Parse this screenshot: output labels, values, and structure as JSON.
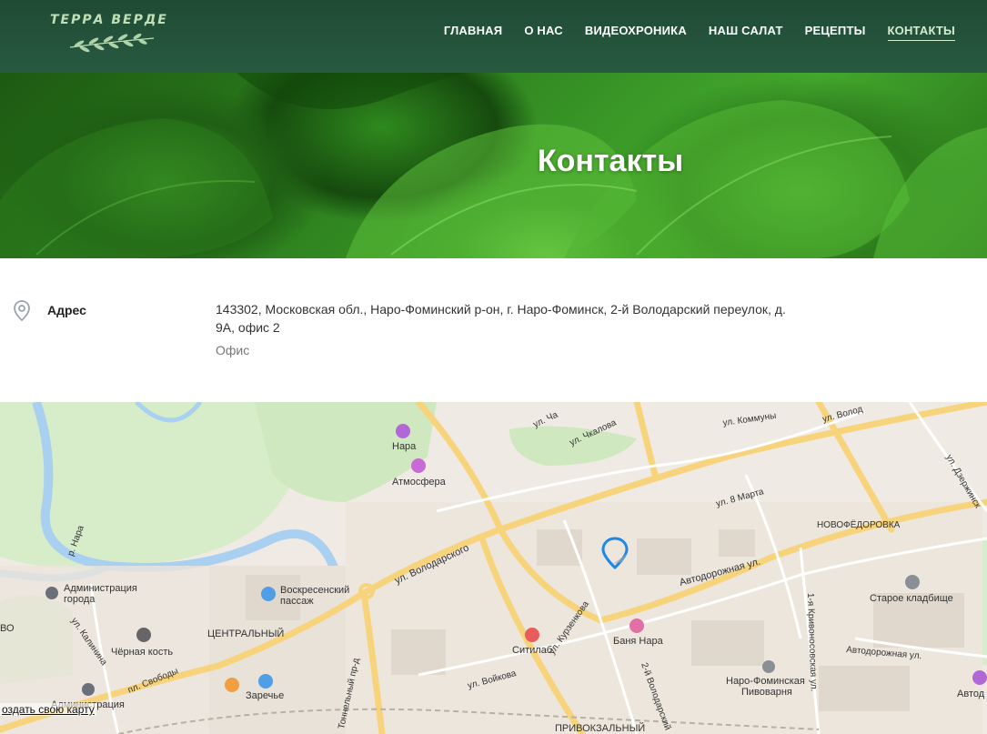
{
  "header": {
    "logo_text": "ТЕРРА ВЕРДЕ",
    "nav": [
      {
        "label": "ГЛАВНАЯ"
      },
      {
        "label": "О НАС"
      },
      {
        "label": "ВИДЕОХРОНИКА"
      },
      {
        "label": "НАШ САЛАТ"
      },
      {
        "label": "РЕЦЕПТЫ"
      },
      {
        "label": "КОНТАКТЫ",
        "active": true
      }
    ]
  },
  "hero": {
    "title": "Контакты"
  },
  "contact": {
    "icon": "location-pin-icon",
    "label": "Адрес",
    "address": "143302, Московская обл., Наро-Фоминский р-он, г. Наро-Фоминск, 2-й Володарский переулок, д. 9А, офис 2",
    "type": "Офис"
  },
  "map": {
    "labels": {
      "nara_river": "р. Нара",
      "nara_poi": "Нара",
      "atmosfera": "Атмосфера",
      "chkalova": "ул. Чкалова",
      "kommuny": "ул. Коммуны",
      "volod": "ул. Волод",
      "dzerzhinsk": "ул. Дзержинск",
      "vosmoe_marta": "ул. 8 Марта",
      "novofedorovka": "НОВОФЁДОРОВКА",
      "volodarskogo": "ул. Володарского",
      "avtodorozhnaya": "Автодорожная ул.",
      "staroe_kladbishche": "Старое кладбище",
      "admin_goroda_1": "Администрация",
      "admin_goroda_2": "города",
      "voskr_1": "Воскресенский",
      "voskr_2": "пассаж",
      "tsentralny": "ЦЕНТРАЛЬНЫЙ",
      "kalinina": "ул. Калинина",
      "chernaya_kost": "Чёрная кость",
      "svobody": "пл. Свободы",
      "sitilab": "Ситилаб",
      "kurzenkova": "ул. Курзенкова",
      "banya_nara": "Баня Нара",
      "vtoroy_volod": "2-й Володарский",
      "krivonosovskaya": "1-я Кривоносовская ул.",
      "avtodorozhnaya2": "Автодорожная ул.",
      "pivovarnya_1": "Наро-Фоминская",
      "pivovarnya_2": "Пивоварня",
      "avtod": "Автод",
      "tonnelny": "Тоннельный пр-д",
      "voykova": "ул. Войкова",
      "zarechye": "Заречье",
      "admin2": "Администрация",
      "privokzalny": "ПРИВОКЗАЛЬНЫЙ",
      "vo": "ВО",
      "ul_cha": "ул. Ча"
    },
    "create_link": "оздать свою карту"
  }
}
